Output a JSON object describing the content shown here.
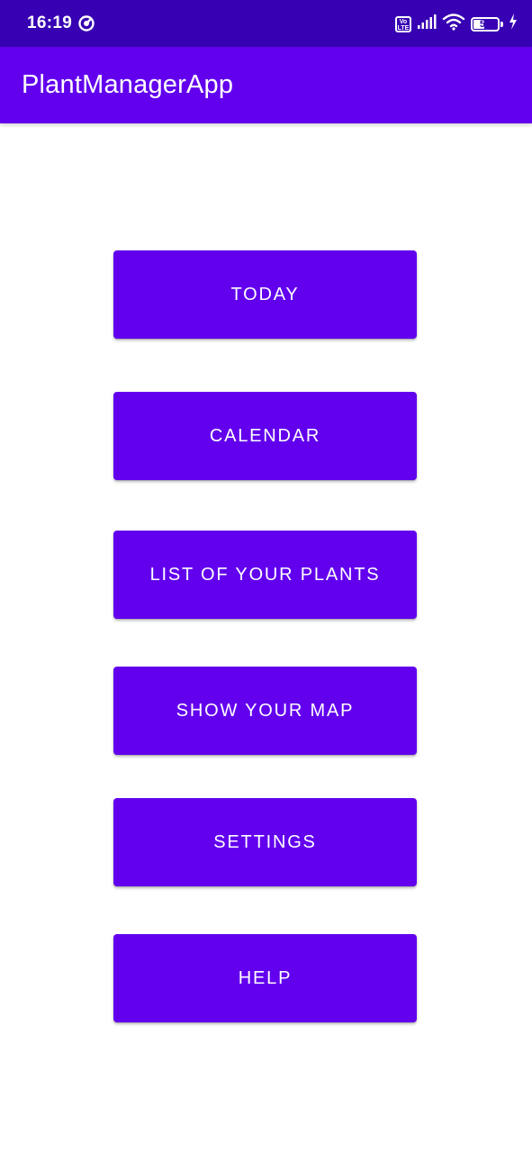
{
  "status_bar": {
    "time": "16:19",
    "volte_label": "Vo LTE",
    "battery_level": "50",
    "battery_fraction": 0.5,
    "icons": [
      "sync-icon",
      "volte-icon",
      "signal-icon",
      "wifi-icon",
      "battery-icon",
      "charging-icon"
    ]
  },
  "app_bar": {
    "title": "PlantManagerApp"
  },
  "menu": {
    "items": [
      {
        "label": "TODAY"
      },
      {
        "label": "CALENDAR"
      },
      {
        "label": "LIST OF YOUR PLANTS"
      },
      {
        "label": "SHOW YOUR MAP"
      },
      {
        "label": "SETTINGS"
      },
      {
        "label": "HELP"
      }
    ]
  },
  "colors": {
    "status_bar": "#3700b3",
    "primary": "#6200ee",
    "background": "#ffffff",
    "on_primary": "#ffffff"
  }
}
